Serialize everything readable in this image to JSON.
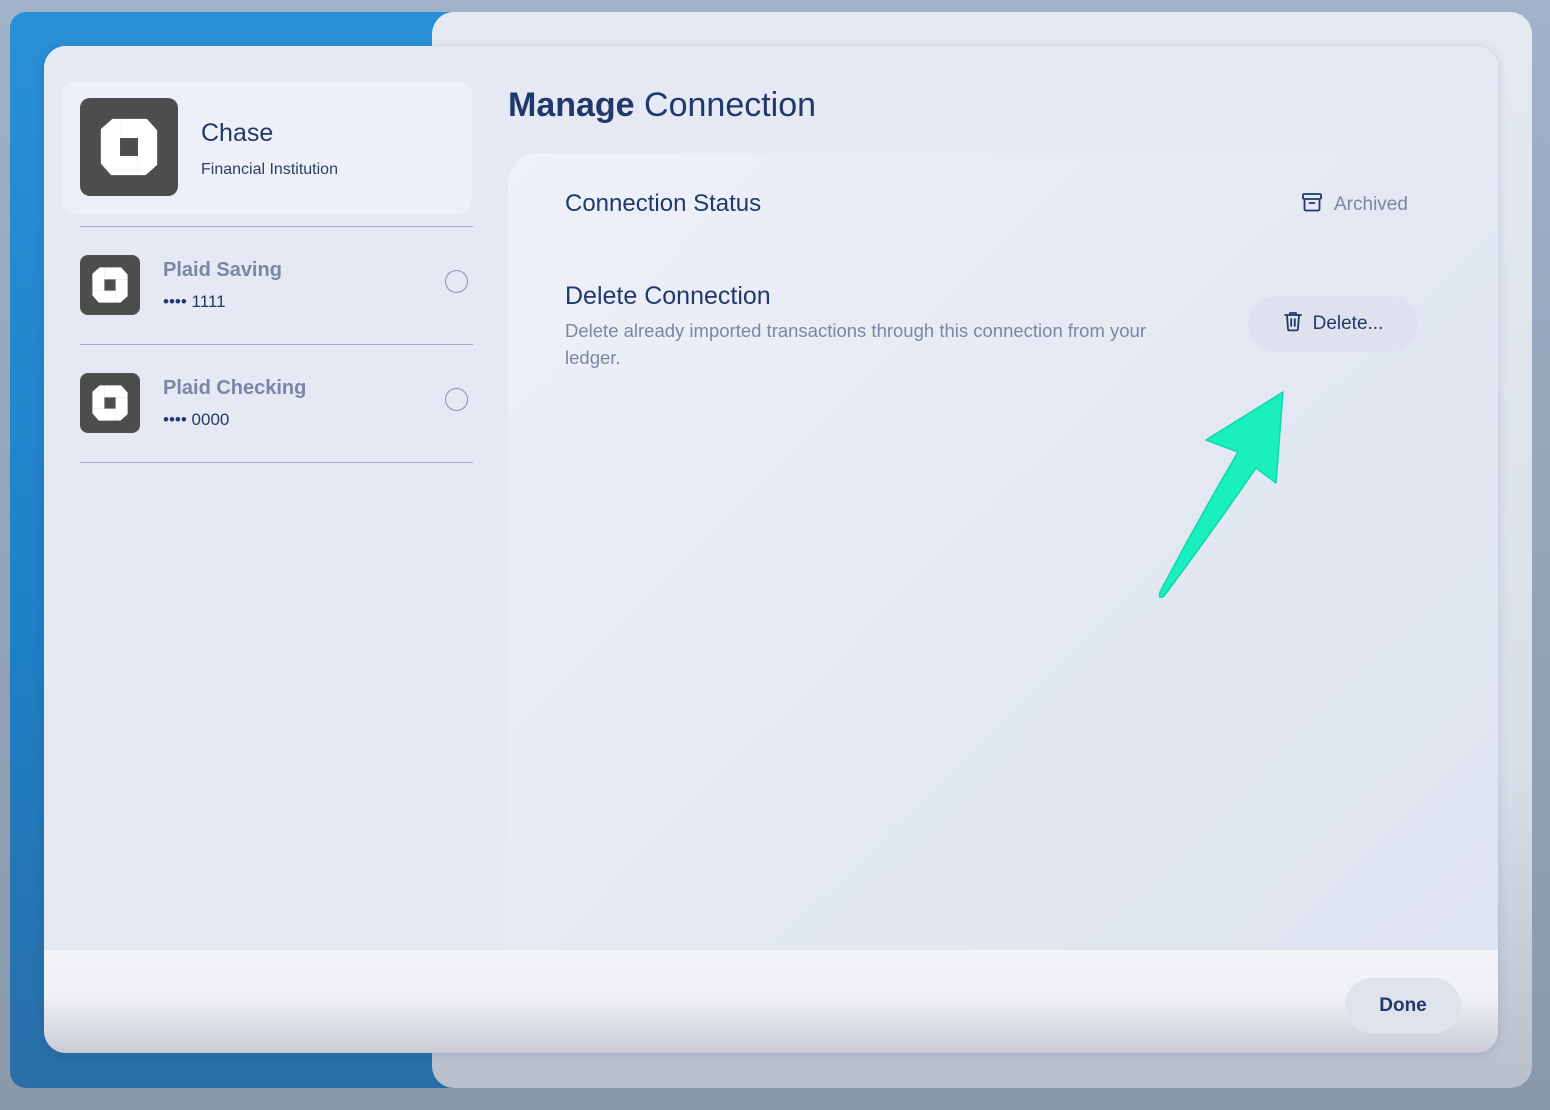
{
  "institution": {
    "name": "Chase",
    "type": "Financial Institution",
    "logo_icon": "chase-octagon-icon"
  },
  "accounts": [
    {
      "name": "Plaid Saving",
      "number": "•••• 1111",
      "selected": false
    },
    {
      "name": "Plaid Checking",
      "number": "•••• 0000",
      "selected": false
    }
  ],
  "header": {
    "title_bold": "Manage",
    "title_rest": " Connection"
  },
  "connection_status": {
    "label": "Connection Status",
    "status": "Archived",
    "status_icon": "archive-icon"
  },
  "delete_section": {
    "title": "Delete Connection",
    "description": "Delete already imported transactions through this connection from your ledger.",
    "button_label": "Delete...",
    "button_icon": "trash-icon"
  },
  "footer": {
    "done_label": "Done"
  },
  "colors": {
    "primary_text": "#23386a",
    "muted_text": "#7a86a3",
    "annotation_arrow": "#19f0be",
    "logo_bg": "#4d4d4d"
  }
}
